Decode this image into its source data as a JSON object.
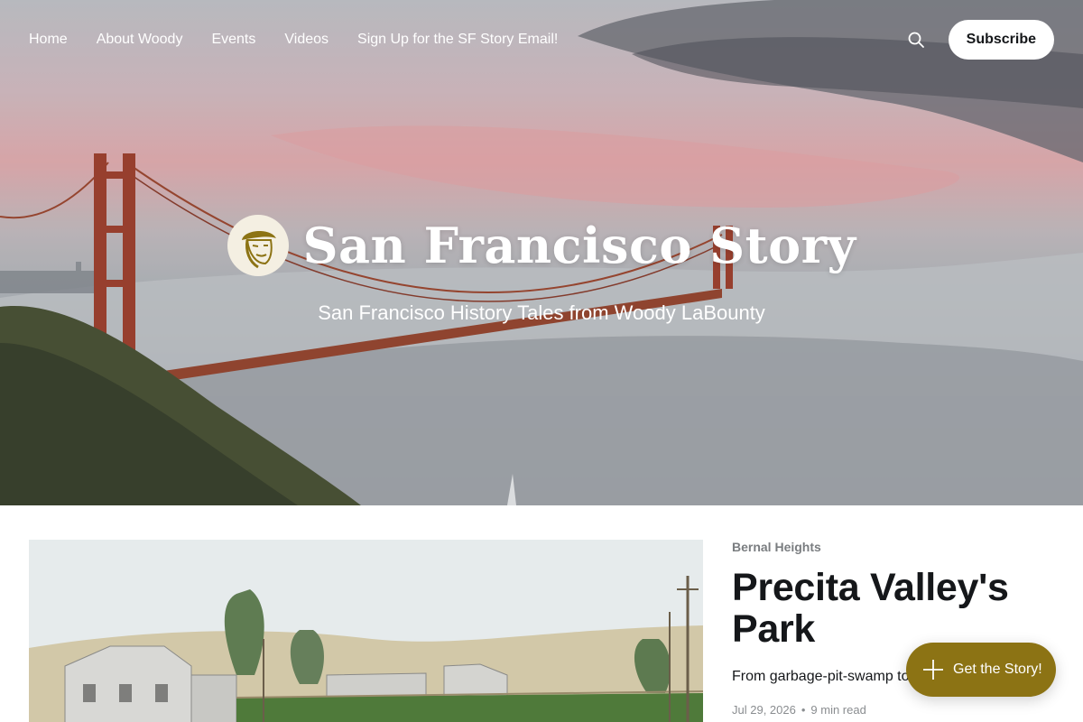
{
  "nav": {
    "links": [
      {
        "label": "Home"
      },
      {
        "label": "About Woody"
      },
      {
        "label": "Events"
      },
      {
        "label": "Videos"
      },
      {
        "label": "Sign Up for the SF Story Email!"
      }
    ],
    "search_icon": "search-icon",
    "subscribe_label": "Subscribe"
  },
  "brand": {
    "title": "San Francisco Story",
    "description": "San Francisco History Tales from Woody LaBounty",
    "logo_icon": "woody-portrait-logo"
  },
  "post": {
    "tag": "Bernal Heights",
    "title": "Precita Valley's Park",
    "excerpt": "From garbage-pit-swamp to",
    "date": "Jul 29, 2026",
    "separator": "•",
    "reading_time": "9 min read"
  },
  "cta": {
    "label": "Get the Story!",
    "icon": "plus-icon"
  },
  "colors": {
    "accent": "#8c7314",
    "text": "#15171a",
    "muted": "#7a7d80"
  }
}
